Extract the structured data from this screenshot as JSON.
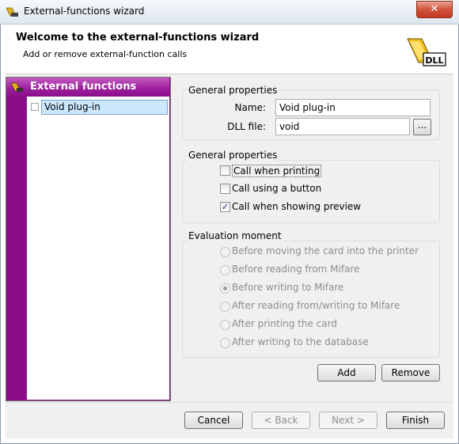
{
  "window": {
    "title": "External-functions wizard",
    "close_glyph": "✕"
  },
  "header": {
    "title": "Welcome to the external-functions wizard",
    "subtitle": "Add or remove external-function calls",
    "logo_text": "DLL"
  },
  "tree": {
    "header_label": "External functions",
    "items": [
      {
        "label": "Void plug-in",
        "selected": true
      }
    ]
  },
  "general": {
    "group_label": "General properties",
    "name_label": "Name:",
    "name_value": "Void plug-in",
    "dll_label": "DLL file:",
    "dll_value": "void",
    "browse_label": "..."
  },
  "options": {
    "group_label": "General properties",
    "items": [
      {
        "label": "Call when printing",
        "checked": false
      },
      {
        "label": "Call using a button",
        "checked": false
      },
      {
        "label": "Call when showing preview",
        "checked": true
      }
    ]
  },
  "evaluation": {
    "group_label": "Evaluation moment",
    "items": [
      {
        "label": "Before moving the card into the printer",
        "selected": false
      },
      {
        "label": "Before reading from Mifare",
        "selected": false
      },
      {
        "label": "Before writing to Mifare",
        "selected": true
      },
      {
        "label": "After reading from/writing to Mifare",
        "selected": false
      },
      {
        "label": "After printing the card",
        "selected": false
      },
      {
        "label": "After writing to the database",
        "selected": false
      }
    ]
  },
  "buttons": {
    "add": "Add",
    "remove": "Remove",
    "cancel": "Cancel",
    "back": "< Back",
    "next": "Next >",
    "finish": "Finish"
  },
  "colors": {
    "tree_accent": "#8a0e8a",
    "selection": "#cce8ff",
    "close_button": "#c23a22"
  }
}
